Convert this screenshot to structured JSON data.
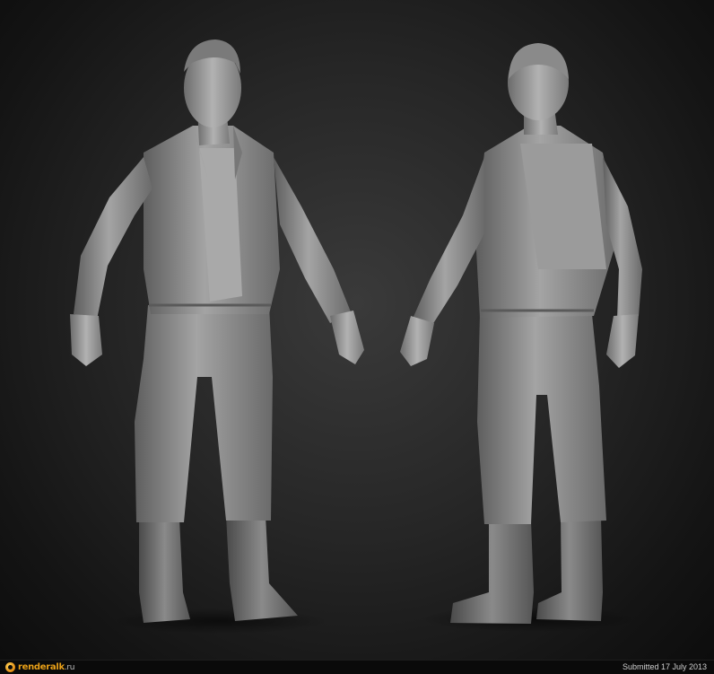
{
  "footer": {
    "logo_text": "renderalk",
    "logo_domain": ".ru",
    "submitted_text": "Submitted 17 July 2013"
  },
  "colors": {
    "background": "#262626",
    "sculpt": "#8e8e8e",
    "logo_accent": "#e9a018"
  }
}
